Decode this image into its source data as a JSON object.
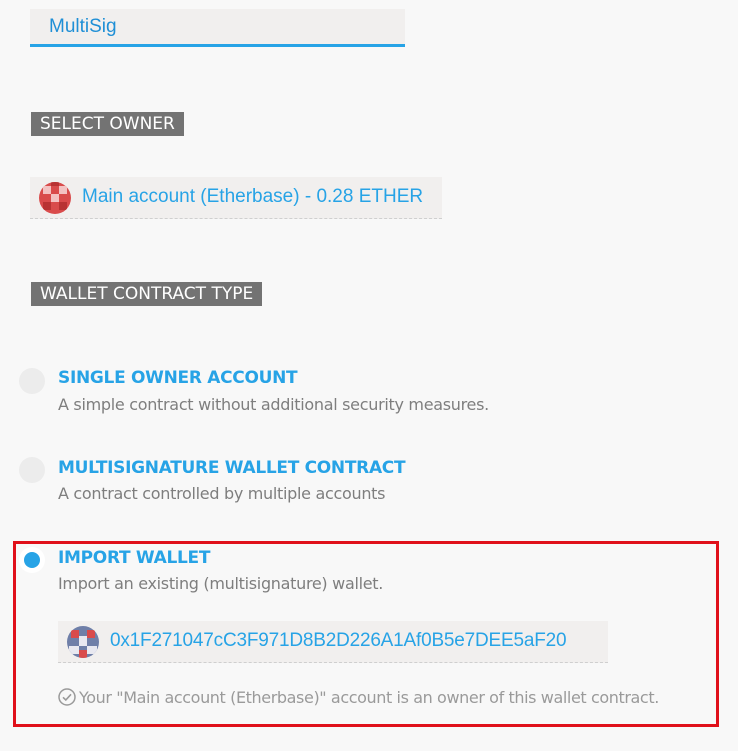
{
  "wallet_name": {
    "value": "MultiSig"
  },
  "select_owner": {
    "heading": "SELECT OWNER",
    "selected_account": "Main account (Etherbase) - 0.28 ETHER",
    "icon": "account-identicon"
  },
  "contract_type": {
    "heading": "WALLET CONTRACT TYPE",
    "options": [
      {
        "title": "SINGLE OWNER ACCOUNT",
        "description": "A simple contract without additional security measures.",
        "selected": false
      },
      {
        "title": "MULTISIGNATURE WALLET CONTRACT",
        "description": "A contract controlled by multiple accounts",
        "selected": false
      },
      {
        "title": "IMPORT WALLET",
        "description": "Import an existing (multisignature) wallet.",
        "selected": true
      }
    ]
  },
  "import_wallet": {
    "address": "0x1F271047cC3F971D8B2D226A1Af0B5e7DEE5aF20",
    "status": "Your \"Main account (Etherbase)\" account is an owner of this wallet contract.",
    "status_icon": "check-circle-icon"
  },
  "colors": {
    "accent": "#27a3e6",
    "label_bg": "#737373",
    "highlight_border": "#e0101a"
  }
}
